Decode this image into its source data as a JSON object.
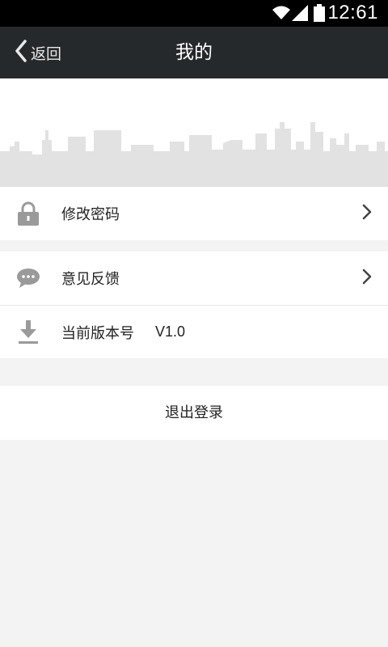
{
  "status_bar": {
    "time": "12:61",
    "icons": [
      "wifi-icon",
      "signal-icon",
      "battery-icon"
    ]
  },
  "nav": {
    "back_label": "返回",
    "title": "我的"
  },
  "menu": {
    "change_password": {
      "label": "修改密码",
      "icon": "lock-icon"
    },
    "feedback": {
      "label": "意见反馈",
      "icon": "chat-bubble-icon"
    },
    "version": {
      "label": "当前版本号",
      "value": "V1.0",
      "icon": "download-icon"
    }
  },
  "logout_label": "退出登录",
  "colors": {
    "status_bar": "#000000",
    "nav_bar": "#26292c",
    "page_bg": "#f3f3f3",
    "card_bg": "#ffffff",
    "icon_gray": "#9a9a9a",
    "skyline": "#e2e2e2"
  }
}
